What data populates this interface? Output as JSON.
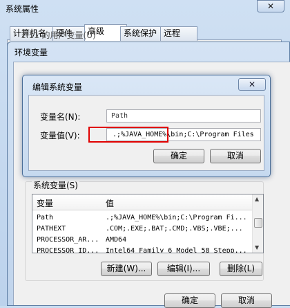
{
  "system_properties": {
    "title": "系统属性",
    "close_glyph": "✕",
    "tabs": [
      "计算机名",
      "硬件",
      "高级",
      "系统保护",
      "远程"
    ],
    "active_tab": "高级",
    "ok_label": "确定",
    "cancel_label": "取消"
  },
  "env_vars": {
    "title": "环境变量",
    "user_group_label": "1.11 的用户变量(U)",
    "system_group_label": "系统变量(S)",
    "columns": [
      "变量",
      "值"
    ],
    "rows": [
      {
        "name": "Path",
        "value": ".;%JAVA_HOME%\\bin;C:\\Program Fi..."
      },
      {
        "name": "PATHEXT",
        "value": ".COM;.EXE;.BAT;.CMD;.VBS;.VBE;..."
      },
      {
        "name": "PROCESSOR_AR...",
        "value": "AMD64"
      },
      {
        "name": "PROCESSOR_ID...",
        "value": "Intel64 Family 6 Model 58 Stepp..."
      }
    ],
    "new_label": "新建(W)...",
    "edit_label": "编辑(I)...",
    "delete_label": "删除(L)"
  },
  "edit_dialog": {
    "title": "编辑系统变量",
    "close_glyph": "✕",
    "name_label": "变量名(N):",
    "name_value": "Path",
    "value_label": "变量值(V):",
    "value_text": ".;%JAVA_HOME%\\bin;C:\\Program Files",
    "ok_label": "确定",
    "cancel_label": "取消"
  },
  "colors": {
    "highlight": "#e00000",
    "title_bar": "#c6d9ef"
  }
}
